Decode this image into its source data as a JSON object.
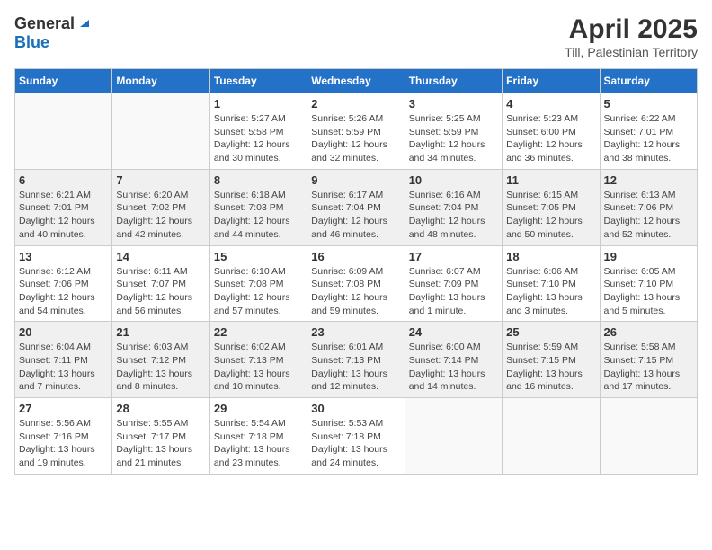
{
  "header": {
    "logo_general": "General",
    "logo_blue": "Blue",
    "month": "April 2025",
    "location": "Till, Palestinian Territory"
  },
  "weekdays": [
    "Sunday",
    "Monday",
    "Tuesday",
    "Wednesday",
    "Thursday",
    "Friday",
    "Saturday"
  ],
  "weeks": [
    [
      {
        "day": "",
        "info": ""
      },
      {
        "day": "",
        "info": ""
      },
      {
        "day": "1",
        "info": "Sunrise: 5:27 AM\nSunset: 5:58 PM\nDaylight: 12 hours\nand 30 minutes."
      },
      {
        "day": "2",
        "info": "Sunrise: 5:26 AM\nSunset: 5:59 PM\nDaylight: 12 hours\nand 32 minutes."
      },
      {
        "day": "3",
        "info": "Sunrise: 5:25 AM\nSunset: 5:59 PM\nDaylight: 12 hours\nand 34 minutes."
      },
      {
        "day": "4",
        "info": "Sunrise: 5:23 AM\nSunset: 6:00 PM\nDaylight: 12 hours\nand 36 minutes."
      },
      {
        "day": "5",
        "info": "Sunrise: 6:22 AM\nSunset: 7:01 PM\nDaylight: 12 hours\nand 38 minutes."
      }
    ],
    [
      {
        "day": "6",
        "info": "Sunrise: 6:21 AM\nSunset: 7:01 PM\nDaylight: 12 hours\nand 40 minutes."
      },
      {
        "day": "7",
        "info": "Sunrise: 6:20 AM\nSunset: 7:02 PM\nDaylight: 12 hours\nand 42 minutes."
      },
      {
        "day": "8",
        "info": "Sunrise: 6:18 AM\nSunset: 7:03 PM\nDaylight: 12 hours\nand 44 minutes."
      },
      {
        "day": "9",
        "info": "Sunrise: 6:17 AM\nSunset: 7:04 PM\nDaylight: 12 hours\nand 46 minutes."
      },
      {
        "day": "10",
        "info": "Sunrise: 6:16 AM\nSunset: 7:04 PM\nDaylight: 12 hours\nand 48 minutes."
      },
      {
        "day": "11",
        "info": "Sunrise: 6:15 AM\nSunset: 7:05 PM\nDaylight: 12 hours\nand 50 minutes."
      },
      {
        "day": "12",
        "info": "Sunrise: 6:13 AM\nSunset: 7:06 PM\nDaylight: 12 hours\nand 52 minutes."
      }
    ],
    [
      {
        "day": "13",
        "info": "Sunrise: 6:12 AM\nSunset: 7:06 PM\nDaylight: 12 hours\nand 54 minutes."
      },
      {
        "day": "14",
        "info": "Sunrise: 6:11 AM\nSunset: 7:07 PM\nDaylight: 12 hours\nand 56 minutes."
      },
      {
        "day": "15",
        "info": "Sunrise: 6:10 AM\nSunset: 7:08 PM\nDaylight: 12 hours\nand 57 minutes."
      },
      {
        "day": "16",
        "info": "Sunrise: 6:09 AM\nSunset: 7:08 PM\nDaylight: 12 hours\nand 59 minutes."
      },
      {
        "day": "17",
        "info": "Sunrise: 6:07 AM\nSunset: 7:09 PM\nDaylight: 13 hours\nand 1 minute."
      },
      {
        "day": "18",
        "info": "Sunrise: 6:06 AM\nSunset: 7:10 PM\nDaylight: 13 hours\nand 3 minutes."
      },
      {
        "day": "19",
        "info": "Sunrise: 6:05 AM\nSunset: 7:10 PM\nDaylight: 13 hours\nand 5 minutes."
      }
    ],
    [
      {
        "day": "20",
        "info": "Sunrise: 6:04 AM\nSunset: 7:11 PM\nDaylight: 13 hours\nand 7 minutes."
      },
      {
        "day": "21",
        "info": "Sunrise: 6:03 AM\nSunset: 7:12 PM\nDaylight: 13 hours\nand 8 minutes."
      },
      {
        "day": "22",
        "info": "Sunrise: 6:02 AM\nSunset: 7:13 PM\nDaylight: 13 hours\nand 10 minutes."
      },
      {
        "day": "23",
        "info": "Sunrise: 6:01 AM\nSunset: 7:13 PM\nDaylight: 13 hours\nand 12 minutes."
      },
      {
        "day": "24",
        "info": "Sunrise: 6:00 AM\nSunset: 7:14 PM\nDaylight: 13 hours\nand 14 minutes."
      },
      {
        "day": "25",
        "info": "Sunrise: 5:59 AM\nSunset: 7:15 PM\nDaylight: 13 hours\nand 16 minutes."
      },
      {
        "day": "26",
        "info": "Sunrise: 5:58 AM\nSunset: 7:15 PM\nDaylight: 13 hours\nand 17 minutes."
      }
    ],
    [
      {
        "day": "27",
        "info": "Sunrise: 5:56 AM\nSunset: 7:16 PM\nDaylight: 13 hours\nand 19 minutes."
      },
      {
        "day": "28",
        "info": "Sunrise: 5:55 AM\nSunset: 7:17 PM\nDaylight: 13 hours\nand 21 minutes."
      },
      {
        "day": "29",
        "info": "Sunrise: 5:54 AM\nSunset: 7:18 PM\nDaylight: 13 hours\nand 23 minutes."
      },
      {
        "day": "30",
        "info": "Sunrise: 5:53 AM\nSunset: 7:18 PM\nDaylight: 13 hours\nand 24 minutes."
      },
      {
        "day": "",
        "info": ""
      },
      {
        "day": "",
        "info": ""
      },
      {
        "day": "",
        "info": ""
      }
    ]
  ]
}
